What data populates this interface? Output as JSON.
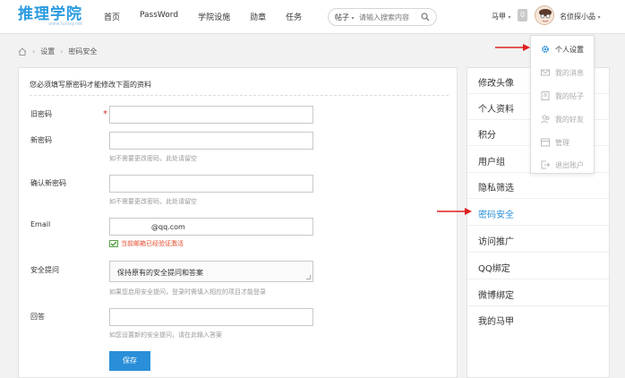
{
  "brand": {
    "logo": "推理学院",
    "logo_sub": "www.tuilixy.net"
  },
  "nav": [
    "首页",
    "PassWord",
    "学院设施",
    "勋章",
    "任务"
  ],
  "search": {
    "category": "帖子",
    "placeholder": "请输入搜索内容"
  },
  "user": {
    "points_menu": "马甲",
    "badge": "0",
    "name": "名侦探小品"
  },
  "breadcrumb": [
    "设置",
    "密码安全"
  ],
  "form": {
    "intro": "您必须填写原密码才能修改下面的资料",
    "old_password_label": "旧密码",
    "new_password_label": "新密码",
    "new_password_hint": "如不需要更改密码，此处请留空",
    "confirm_label": "确认新密码",
    "confirm_hint": "如不需要更改密码，此处请留空",
    "email_label": "Email",
    "email_value": "@qq.com",
    "email_verified": "当前邮箱已经验证激活",
    "question_label": "安全提问",
    "question_value": "保持原有的安全提问和答案",
    "question_hint": "如果您启用安全提问，登录时需填入相应的项目才能登录",
    "answer_label": "回答",
    "answer_hint": "如您设置新的安全提问，请在此输入答案",
    "save_label": "保存"
  },
  "side_menu": [
    "修改头像",
    "个人资料",
    "积分",
    "用户组",
    "隐私筛选",
    "密码安全",
    "访问推广",
    "QQ绑定",
    "微博绑定",
    "我的马甲"
  ],
  "side_active": "密码安全",
  "dropdown": [
    "个人设置",
    "我的消息",
    "我的帖子",
    "我的好友",
    "管理",
    "退出账户"
  ],
  "colors": {
    "accent": "#2a8fd8",
    "arrow": "#e02020",
    "warning": "#e44a2a"
  }
}
